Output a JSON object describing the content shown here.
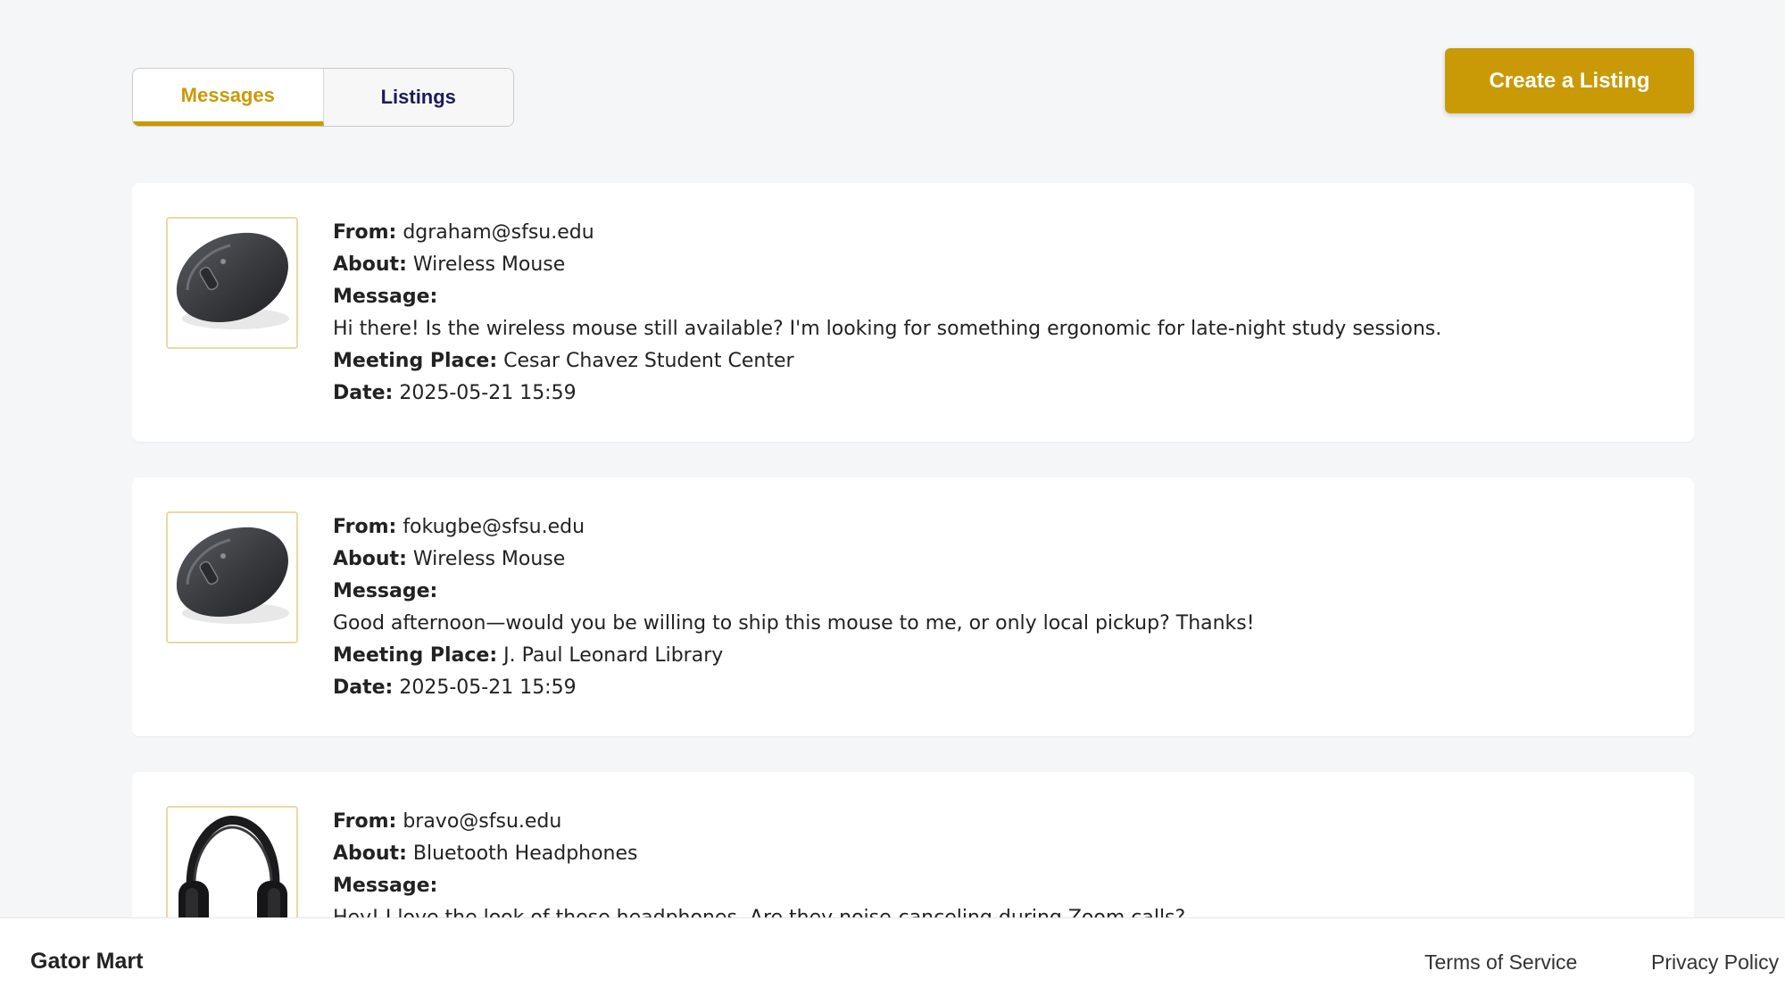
{
  "tabs": [
    {
      "label": "Messages",
      "active": true
    },
    {
      "label": "Listings",
      "active": false
    }
  ],
  "header": {
    "create_label": "Create a Listing"
  },
  "labels": {
    "from": "From:",
    "about": "About:",
    "message": "Message:",
    "meeting": "Meeting Place:",
    "date": "Date:"
  },
  "messages": [
    {
      "from": "dgraham@sfsu.edu",
      "about": "Wireless Mouse",
      "text": "Hi there! Is the wireless mouse still available? I'm looking for something ergonomic for late-night study sessions.",
      "meeting_place": "Cesar Chavez Student Center",
      "date": "2025-05-21 15:59",
      "image_icon": "wireless-mouse"
    },
    {
      "from": "fokugbe@sfsu.edu",
      "about": "Wireless Mouse",
      "text": "Good afternoon—would you be willing to ship this mouse to me, or only local pickup? Thanks!",
      "meeting_place": "J. Paul Leonard Library",
      "date": "2025-05-21 15:59",
      "image_icon": "wireless-mouse"
    },
    {
      "from": "bravo@sfsu.edu",
      "about": "Bluetooth Headphones",
      "text": "Hey! I love the look of these headphones. Are they noise-canceling during Zoom calls?",
      "meeting_place": "",
      "date": "",
      "image_icon": "bluetooth-headphones"
    }
  ],
  "footer": {
    "brand": "Gator Mart",
    "links": [
      "Terms of Service",
      "Privacy Policy"
    ]
  },
  "colors": {
    "accent": "#c99a06",
    "tab_inactive_text": "#1c1c5a",
    "background": "#f5f6f8"
  }
}
